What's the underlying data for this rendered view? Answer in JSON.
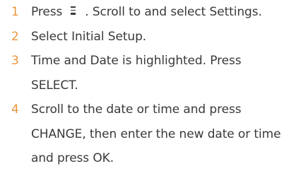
{
  "steps": [
    {
      "number": "1",
      "before_icon": "Press",
      "icon": "menu-icon",
      "after_icon": ". Scroll to and select Settings."
    },
    {
      "number": "2",
      "text": "Select Initial Setup."
    },
    {
      "number": "3",
      "text": "Time and Date is highlighted. Press SELECT."
    },
    {
      "number": "4",
      "text": "Scroll to the date or time and press CHANGE, then enter the new date or time and press OK."
    }
  ],
  "colors": {
    "step_number": "#e8963c",
    "body_text": "#3a3a3a"
  }
}
